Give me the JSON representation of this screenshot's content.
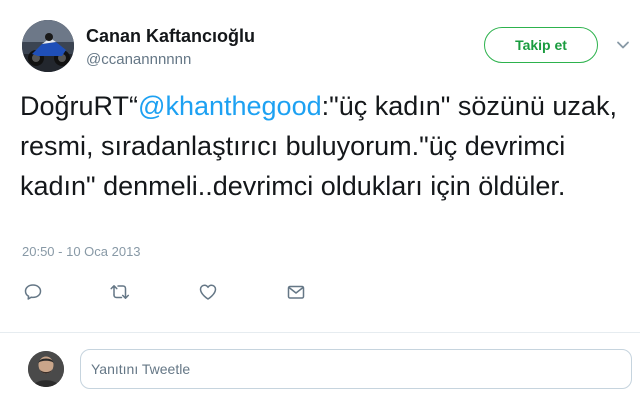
{
  "author": {
    "name": "Canan Kaftancıoğlu",
    "handle": "@ccanannnnnn"
  },
  "follow_button": {
    "label": "Takip et"
  },
  "tweet": {
    "prefix": "DoğruRT“",
    "mention": "@khanthegood",
    "body": ":\"üç kadın\" sözünü uzak, resmi, sıradanlaştırıcı buluyorum.\"üç devrimci kadın\" denmeli..devrimci oldukları için öldüler.",
    "timestamp": "20:50 - 10 Oca 2013"
  },
  "actions": {
    "icons": [
      "reply-icon",
      "retweet-icon",
      "like-icon",
      "direct-message-icon"
    ]
  },
  "reply": {
    "placeholder": "Yanıtını Tweetle"
  },
  "colors": {
    "mention": "#1da1f2",
    "follow_border": "#2db24d",
    "follow_text": "#1a9c3f",
    "secondary_text": "#657786",
    "icon": "#657786"
  }
}
